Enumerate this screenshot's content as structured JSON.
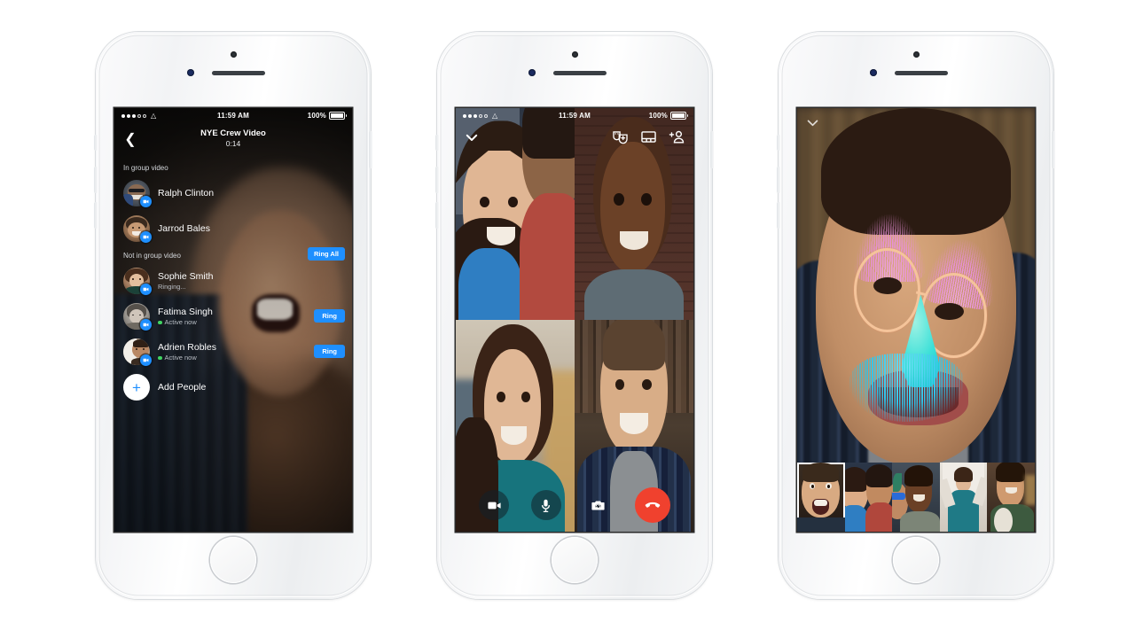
{
  "page": {
    "background": "#ffffff",
    "device_count": 3,
    "brand_blue": "#1E8FFF",
    "end_call_red": "#F0412E",
    "active_green": "#41d362"
  },
  "shared": {
    "status_bar": {
      "time": "11:59 AM",
      "battery_label": "100%",
      "signal_dots_filled": 3,
      "signal_dots_total": 5,
      "wifi_icon": "wifi-icon",
      "battery_icon": "battery-full-icon"
    },
    "device_icons": {
      "camera": "front-camera-icon",
      "sensor": "proximity-sensor-icon",
      "earpiece": "earpiece-speaker-icon",
      "home": "home-button-icon"
    }
  },
  "phone1": {
    "name": "group-video-participants-screen",
    "nav": {
      "back_icon": "chevron-left-icon",
      "title": "NYE Crew Video",
      "timer": "0:14"
    },
    "sections": [
      {
        "header": "In group video",
        "action_label": null,
        "rows": [
          {
            "name": "Ralph Clinton",
            "status": null,
            "status_type": "none",
            "action": null,
            "badge": "video-camera-badge"
          },
          {
            "name": "Jarrod Bales",
            "status": null,
            "status_type": "none",
            "action": null,
            "badge": "video-camera-badge"
          }
        ]
      },
      {
        "header": "Not in group video",
        "action_label": "Ring All",
        "rows": [
          {
            "name": "Sophie Smith",
            "status": "Ringing...",
            "status_type": "ringing",
            "action": null,
            "badge": "video-camera-badge"
          },
          {
            "name": "Fatima Singh",
            "status": "Active now",
            "status_type": "active",
            "action": "Ring",
            "badge": "video-camera-badge"
          },
          {
            "name": "Adrien Robles",
            "status": "Active now",
            "status_type": "active",
            "action": "Ring",
            "badge": "video-camera-badge"
          }
        ]
      }
    ],
    "add_people": {
      "label": "Add People",
      "icon": "plus-icon"
    }
  },
  "phone2": {
    "name": "group-video-grid-screen",
    "topbar": {
      "minimize_icon": "chevron-down-icon",
      "actions": [
        {
          "icon": "masks-effects-icon",
          "label": "Effects"
        },
        {
          "icon": "layout-switch-icon",
          "label": "Layout"
        },
        {
          "icon": "add-person-icon",
          "label": "Add person"
        }
      ]
    },
    "tiles": [
      {
        "label": "Participant 1",
        "position": "top-left"
      },
      {
        "label": "Participant 2",
        "position": "top-right"
      },
      {
        "label": "Participant 3",
        "position": "bottom-left"
      },
      {
        "label": "Participant 4",
        "position": "bottom-right"
      }
    ],
    "controls": [
      {
        "icon": "video-camera-icon",
        "label": "Toggle video",
        "style": "dark"
      },
      {
        "icon": "microphone-icon",
        "label": "Toggle mic",
        "style": "dark"
      },
      {
        "icon": "camera-flip-icon",
        "label": "Flip camera",
        "style": "plain"
      },
      {
        "icon": "end-call-icon",
        "label": "End call",
        "style": "end"
      }
    ]
  },
  "phone3": {
    "name": "video-filter-fullscreen",
    "minimize_icon": "chevron-down-icon",
    "filter": {
      "name": "disguise-mask-filter",
      "glasses_color": "#f5c49a",
      "eyebrow_color": "#e78fd6",
      "nose_color": "#3ce0d8",
      "mustache_color": "#2fc3e8"
    },
    "filmstrip": [
      {
        "label": "Self view",
        "selected": true
      },
      {
        "label": "Couple",
        "selected": false
      },
      {
        "label": "Friends with glasses",
        "selected": false
      },
      {
        "label": "Woman cheering",
        "selected": false
      },
      {
        "label": "Man with dog",
        "selected": false
      }
    ]
  }
}
